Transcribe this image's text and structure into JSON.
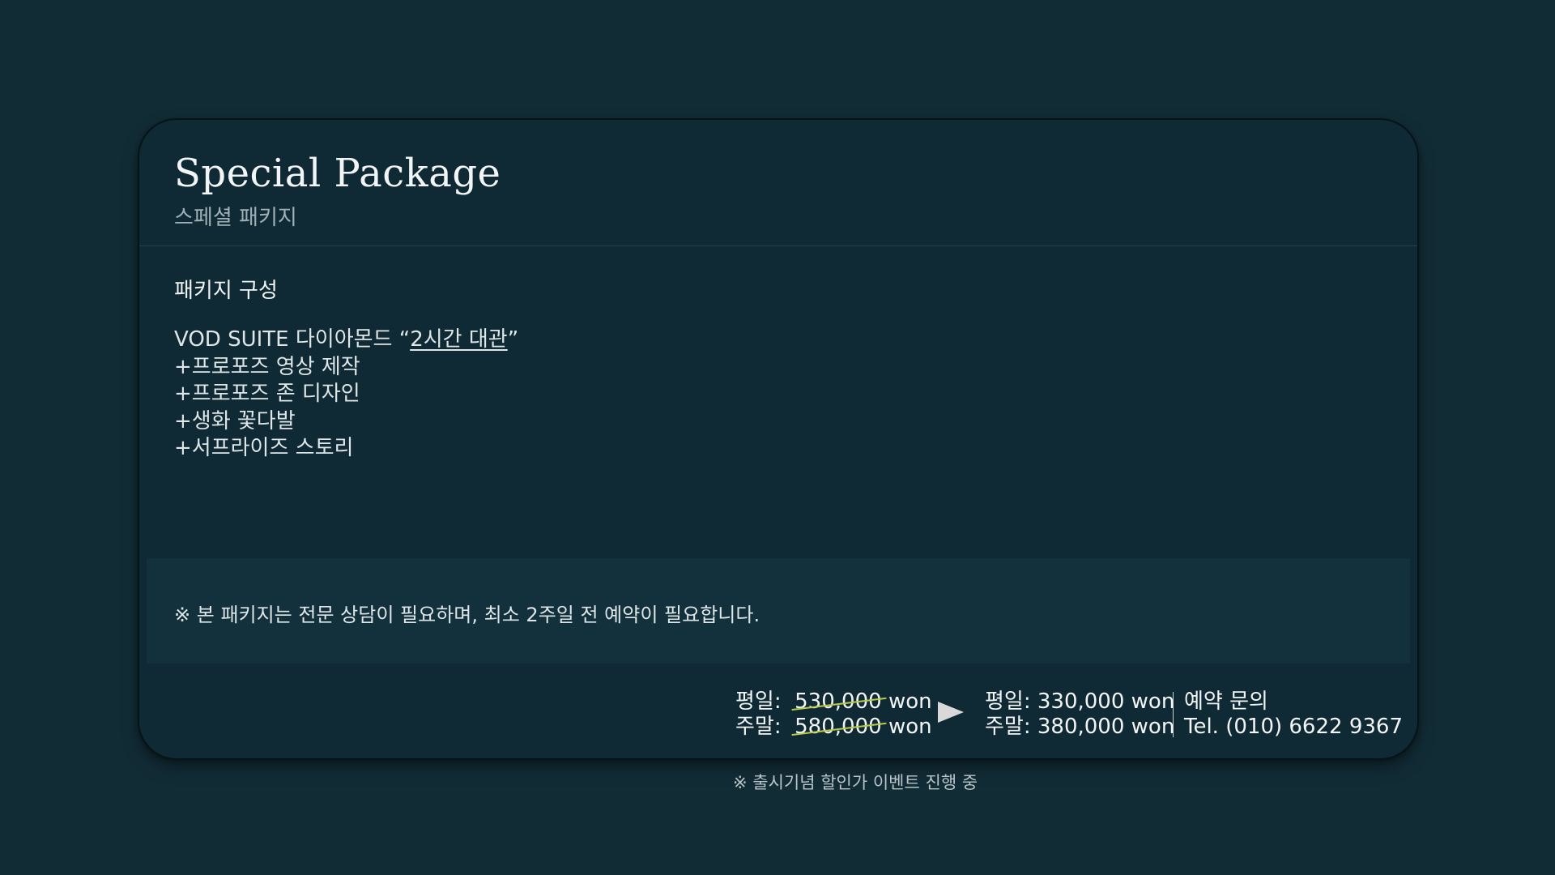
{
  "header": {
    "title": "Special Package",
    "subtitle": "스페셜 패키지"
  },
  "composition": {
    "title": "패키지 구성",
    "line1_prefix": "VOD SUITE 다이아몬드 “",
    "line1_underlined": "2시간 대관",
    "line1_suffix": "”",
    "items": [
      "+프로포즈 영상 제작",
      "+프로포즈 존 디자인",
      "+생화 꽃다발",
      "+서프라이즈 스토리"
    ]
  },
  "notice": "※ 본 패키지는 전문 상담이 필요하며, 최소 2주일 전 예약이 필요합니다.",
  "pricing": {
    "old": [
      {
        "label": "평일:",
        "value": "530,000",
        "unit": "won"
      },
      {
        "label": "주말:",
        "value": "580,000",
        "unit": "won"
      }
    ],
    "new": [
      {
        "label": "평일:",
        "text": "330,000 won"
      },
      {
        "label": "주말:",
        "text": "380,000 won"
      }
    ],
    "strike_color": "#b9cb4a"
  },
  "contact": {
    "title": "예약 문의",
    "tel": "Tel. (010) 6622 9367"
  },
  "footnote": "※ 출시기념 할인가 이벤트 진행 중",
  "colors": {
    "background": "#122c36",
    "card": "#0f2a34",
    "notice_band": "#12313c",
    "arrow": "#d9d9d9"
  },
  "icons": {
    "arrow": "play-arrow-icon"
  }
}
